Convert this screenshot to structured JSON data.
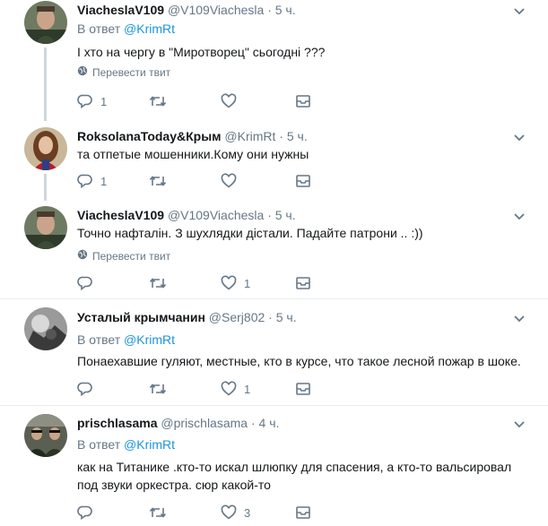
{
  "tweets": [
    {
      "name": "ViacheslaV109",
      "handle": "@V109Viachesla",
      "dot": "·",
      "time": "5 ч.",
      "reply_prefix": "В ответ",
      "reply_to": "@KrimRt",
      "text": "І хто на чергу в \"Миротворец\" сьогодні ???",
      "translate": "Перевести твит",
      "replies": "1",
      "retweets": "",
      "likes": ""
    },
    {
      "name": "RoksolanaToday&Крым",
      "handle": "@KrimRt",
      "dot": "·",
      "time": "5 ч.",
      "text": "та отпетые мошенники.Кому они нужны",
      "replies": "1",
      "retweets": "",
      "likes": ""
    },
    {
      "name": "ViacheslaV109",
      "handle": "@V109Viachesla",
      "dot": "·",
      "time": "5 ч.",
      "text": "Точно нафталін. З шухлядки дістали. Падайте патрони .. :))",
      "translate": "Перевести твит",
      "replies": "",
      "retweets": "",
      "likes": "1"
    },
    {
      "name": "Усталый крымчанин",
      "handle": "@Serj802",
      "dot": "·",
      "time": "5 ч.",
      "reply_prefix": "В ответ",
      "reply_to": "@KrimRt",
      "text": "Понаехавшие гуляют, местные, кто в курсе, что такое лесной пожар в шоке.",
      "replies": "",
      "retweets": "",
      "likes": "1"
    },
    {
      "name": "prischlasama",
      "handle": "@prischlasama",
      "dot": "·",
      "time": "4 ч.",
      "reply_prefix": "В ответ",
      "reply_to": "@KrimRt",
      "text": "как на Титанике .кто-то искал шлюпку для спасения, а кто-то вальсировал под звуки оркестра. сюр какой-то",
      "replies": "",
      "retweets": "",
      "likes": "3"
    }
  ],
  "colors": {
    "link": "#1b95e0",
    "muted": "#657786",
    "text": "#14171a",
    "thread_line": "#ccd6dd",
    "divider": "#e6ecf0"
  },
  "icons": [
    "reply-icon",
    "retweet-icon",
    "like-icon",
    "direct-message-icon",
    "chevron-down-icon",
    "globe-icon"
  ]
}
